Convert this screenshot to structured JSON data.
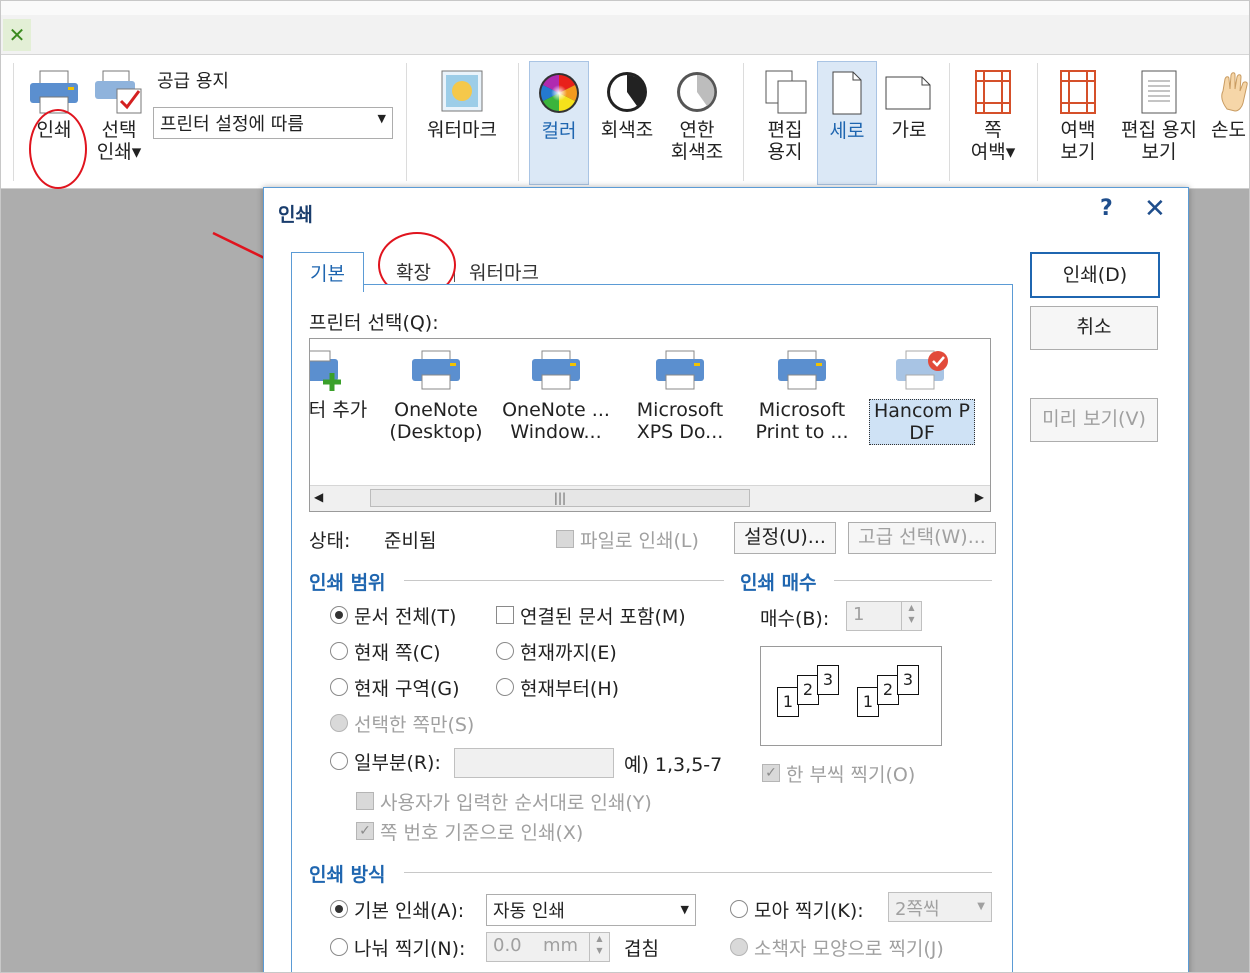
{
  "ribbon": {
    "print_label": "인쇄",
    "select_print_label": "선택\n인쇄",
    "paper_source_label": "공급 용지",
    "paper_source_value": "프린터 설정에 따름",
    "watermark_label": "워터마크",
    "color_label": "컬러",
    "grayscale_label": "회색조",
    "light_grayscale_label": "연한\n회색조",
    "edit_paper_label": "편집\n용지",
    "portrait_label": "세로",
    "landscape_label": "가로",
    "page_margin_label": "쪽\n여백",
    "margin_view_label": "여백\n보기",
    "edit_paper_view_label": "편집 용지\n보기",
    "hand_tool_label": "손도"
  },
  "dialog": {
    "title": "인쇄",
    "help": "?",
    "close": "✕",
    "tabs": [
      "기본",
      "확장",
      "워터마크"
    ],
    "buttons": {
      "print": "인쇄(D)",
      "cancel": "취소",
      "preview": "미리 보기(V)"
    },
    "printer_select_label": "프린터 선택(Q):",
    "printers": [
      {
        "name": "터 추가"
      },
      {
        "name": "OneNote\n(Desktop)"
      },
      {
        "name": "OneNote ...\nWindow..."
      },
      {
        "name": "Microsoft\nXPS Do..."
      },
      {
        "name": "Microsoft\nPrint to ..."
      },
      {
        "name": "Hancom P\nDF"
      }
    ],
    "status_label": "상태:",
    "status_value": "준비됨",
    "print_to_file": "파일로 인쇄(L)",
    "settings_button": "설정(U)...",
    "advanced_button": "고급 선택(W)...",
    "range": {
      "title": "인쇄 범위",
      "whole_doc": "문서 전체(T)",
      "linked_docs": "연결된 문서 포함(M)",
      "current_page": "현재 쪽(C)",
      "up_to_current": "현재까지(E)",
      "current_section": "현재 구역(G)",
      "from_current": "현재부터(H)",
      "selected_pages": "선택한 쪽만(S)",
      "partial": "일부분(R):",
      "partial_example": "예) 1,3,5-7",
      "user_order": "사용자가 입력한 순서대로 인쇄(Y)",
      "page_number_based": "쪽 번호 기준으로 인쇄(X)"
    },
    "copies": {
      "title": "인쇄 매수",
      "count_label": "매수(B):",
      "count_value": "1",
      "collate": "한 부씩 찍기(O)"
    },
    "method": {
      "title": "인쇄 방식",
      "basic": "기본 인쇄(A):",
      "basic_value": "자동 인쇄",
      "collect": "모아 찍기(K):",
      "collect_value": "2쪽씩",
      "split": "나눠 찍기(N):",
      "split_value": "0.0",
      "split_unit": "mm",
      "overlap": "겹침",
      "booklet": "소책자 모양으로 찍기(J)"
    }
  }
}
